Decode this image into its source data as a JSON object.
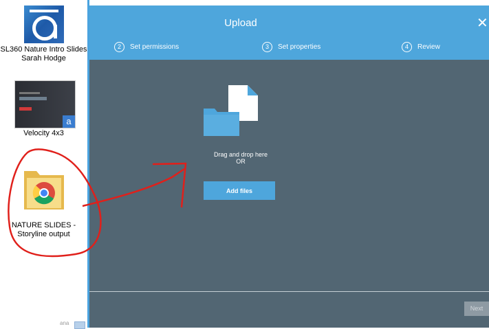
{
  "desktop": {
    "items": [
      {
        "label": "SL360 Nature Intro Slides Sarah Hodge",
        "icon": "articulate-360-icon"
      },
      {
        "label": "Velocity 4x3",
        "icon": "presentation-thumbnail",
        "thumb_badge": "a"
      },
      {
        "label": "NATURE SLIDES - Storyline output",
        "icon": "chrome-folder-icon"
      }
    ],
    "grid_label": "ana"
  },
  "dialog": {
    "title": "Upload",
    "steps": [
      {
        "number": "2",
        "label": "Set permissions"
      },
      {
        "number": "3",
        "label": "Set properties"
      },
      {
        "number": "4",
        "label": "Review"
      }
    ],
    "close_icon": "close-icon",
    "drop_text_line1": "Drag and drop here",
    "drop_text_line2": "OR",
    "add_files_label": "Add files",
    "next_label": "Next"
  },
  "colors": {
    "header_blue": "#4ea6dc",
    "dialog_body": "#526673",
    "annotation_red": "#e0201b"
  }
}
